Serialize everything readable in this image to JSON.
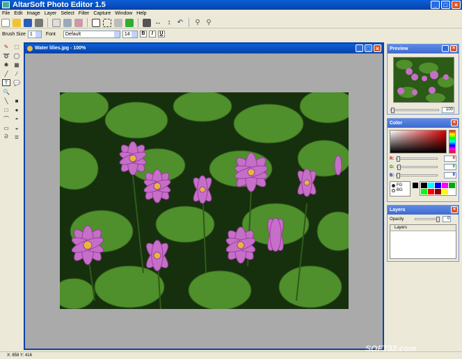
{
  "window": {
    "title": "AltarSoft Photo Editor 1.5"
  },
  "menu": [
    "File",
    "Edit",
    "Image",
    "Layer",
    "Select",
    "Filter",
    "Capture",
    "Window",
    "Help"
  ],
  "options": {
    "brush_size_label": "Brush Size",
    "brush_size_value": "1",
    "font_label": "Font",
    "font_value": "Default",
    "font_size_value": "14",
    "bold": "B",
    "italic": "I",
    "underline": "U"
  },
  "document": {
    "title": "Water lilies.jpg - 100%"
  },
  "preview": {
    "title": "Preview",
    "zoom_value": "100"
  },
  "color": {
    "title": "Color",
    "r_label": "R:",
    "g_label": "G:",
    "b_label": "B:",
    "r_value": "0",
    "g_value": "0",
    "b_value": "0",
    "fg_label": "FG",
    "bg_label": "BG",
    "swatches": [
      "#000000",
      "#00ffff",
      "#0000ff",
      "#ff00ff",
      "#00aa00",
      "#00ff00",
      "#ff0000",
      "#880000",
      "#ffff00",
      "#ffffff"
    ]
  },
  "layers": {
    "title": "Layers",
    "opacity_label": "Opacity",
    "opacity_value": "0",
    "column_label": "Layers"
  },
  "status": {
    "coords": "X: 858 Y: 416"
  },
  "watermark": "SOFT32.com",
  "colors": {
    "titlebar": "#0842a8",
    "panel_title": "#3e6ad0",
    "close": "#d9542a"
  }
}
